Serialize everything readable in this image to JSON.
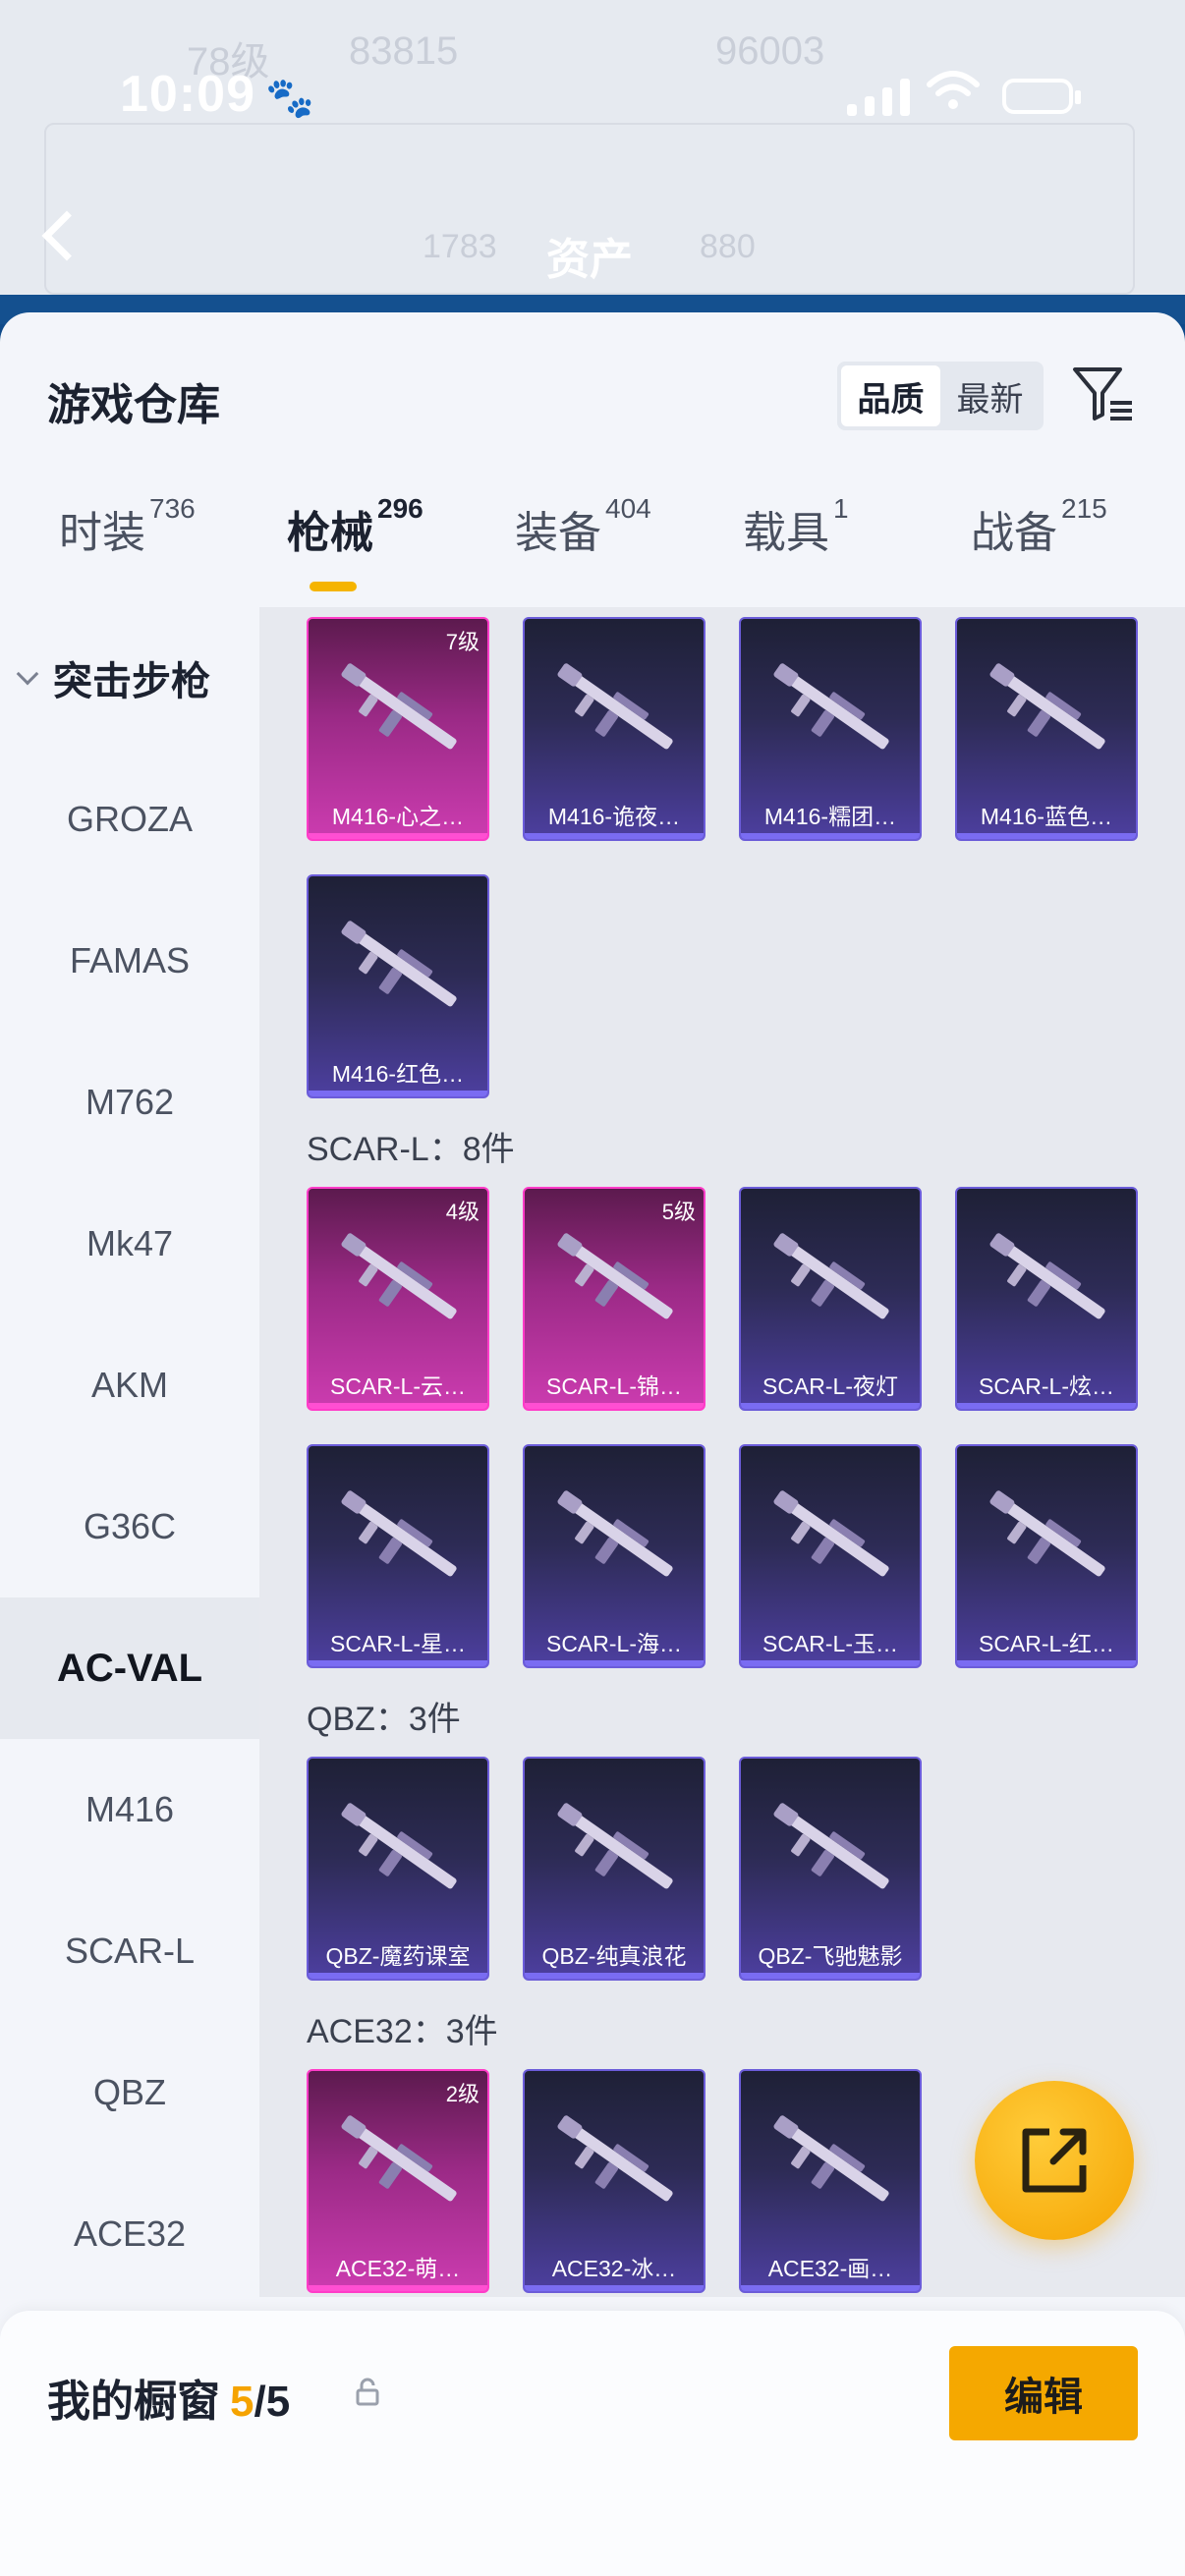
{
  "status_bar": {
    "time": "10:09"
  },
  "background": {
    "title": "资产",
    "faded_stats": [
      "78级",
      "83815",
      "96003",
      "1783",
      "880"
    ]
  },
  "sheet": {
    "title": "游戏仓库",
    "sort": {
      "options": [
        "品质",
        "最新"
      ],
      "selected": "品质"
    },
    "filter_icon": "filter-list-icon"
  },
  "tabs": [
    {
      "label": "时装",
      "count": "736"
    },
    {
      "label": "枪械",
      "count": "296",
      "active": true
    },
    {
      "label": "装备",
      "count": "404"
    },
    {
      "label": "载具",
      "count": "1"
    },
    {
      "label": "战备",
      "count": "215"
    }
  ],
  "sidebar": {
    "category": "突击步枪",
    "items": [
      "GROZA",
      "FAMAS",
      "M762",
      "Mk47",
      "AKM",
      "G36C",
      "AC-VAL",
      "M416",
      "SCAR-L",
      "QBZ",
      "ACE32"
    ],
    "selected": "AC-VAL"
  },
  "groups": {
    "m416": {
      "cards": [
        {
          "name": "M416-心之…",
          "level": "7级",
          "rarity": "pink"
        },
        {
          "name": "M416-诡夜…",
          "level": "",
          "rarity": "purple"
        },
        {
          "name": "M416-糯团…",
          "level": "",
          "rarity": "purple"
        },
        {
          "name": "M416-蓝色…",
          "level": "",
          "rarity": "purple"
        },
        {
          "name": "M416-红色…",
          "level": "",
          "rarity": "purple"
        }
      ]
    },
    "scar": {
      "label": "SCAR-L：8件",
      "cards": [
        {
          "name": "SCAR-L-云…",
          "level": "4级",
          "rarity": "pink"
        },
        {
          "name": "SCAR-L-锦…",
          "level": "5级",
          "rarity": "pink"
        },
        {
          "name": "SCAR-L-夜灯",
          "level": "",
          "rarity": "purple"
        },
        {
          "name": "SCAR-L-炫…",
          "level": "",
          "rarity": "purple"
        },
        {
          "name": "SCAR-L-星…",
          "level": "",
          "rarity": "purple"
        },
        {
          "name": "SCAR-L-海…",
          "level": "",
          "rarity": "purple"
        },
        {
          "name": "SCAR-L-玉…",
          "level": "",
          "rarity": "purple"
        },
        {
          "name": "SCAR-L-红…",
          "level": "",
          "rarity": "purple"
        }
      ]
    },
    "qbz": {
      "label": "QBZ：3件",
      "cards": [
        {
          "name": "QBZ-魔药课室",
          "level": "",
          "rarity": "purple"
        },
        {
          "name": "QBZ-纯真浪花",
          "level": "",
          "rarity": "purple"
        },
        {
          "name": "QBZ-飞驰魅影",
          "level": "",
          "rarity": "purple"
        }
      ]
    },
    "ace": {
      "label": "ACE32：3件",
      "cards": [
        {
          "name": "ACE32-萌…",
          "level": "2级",
          "rarity": "pink"
        },
        {
          "name": "ACE32-冰…",
          "level": "",
          "rarity": "purple"
        },
        {
          "name": "ACE32-画…",
          "level": "",
          "rarity": "purple"
        }
      ]
    }
  },
  "fab": {
    "icon": "share-external-icon"
  },
  "showcase": {
    "label": "我的橱窗",
    "current": "5",
    "total": "/5",
    "edit_label": "编辑"
  },
  "colors": {
    "accent": "#f5a800",
    "pink_rarity": "#ff3cc8",
    "purple_rarity": "#6b5cd9"
  }
}
